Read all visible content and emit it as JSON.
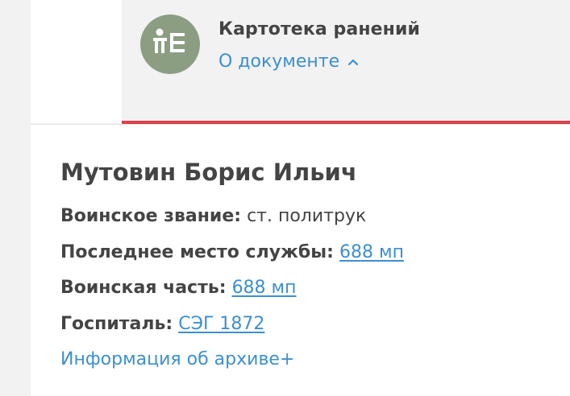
{
  "document": {
    "icon": "person-document-icon",
    "title": "Картотека ранений",
    "toggle_label": "О документе",
    "toggle_icon": "chevron-up-icon"
  },
  "person": {
    "name": "Мутовин Борис Ильич",
    "rank_label": "Воинское звание:",
    "rank_value": "ст. политрук",
    "last_service_label": "Последнее место службы:",
    "last_service_value": "688 мп",
    "unit_label": "Воинская часть:",
    "unit_value": "688 мп",
    "hospital_label": "Госпиталь:",
    "hospital_value": "СЭГ 1872"
  },
  "archive_link": "Информация об архиве+",
  "colors": {
    "accent": "#3d8fd1",
    "divider_red": "#d9414a",
    "avatar_bg": "#8c9e82",
    "text": "#444444"
  }
}
